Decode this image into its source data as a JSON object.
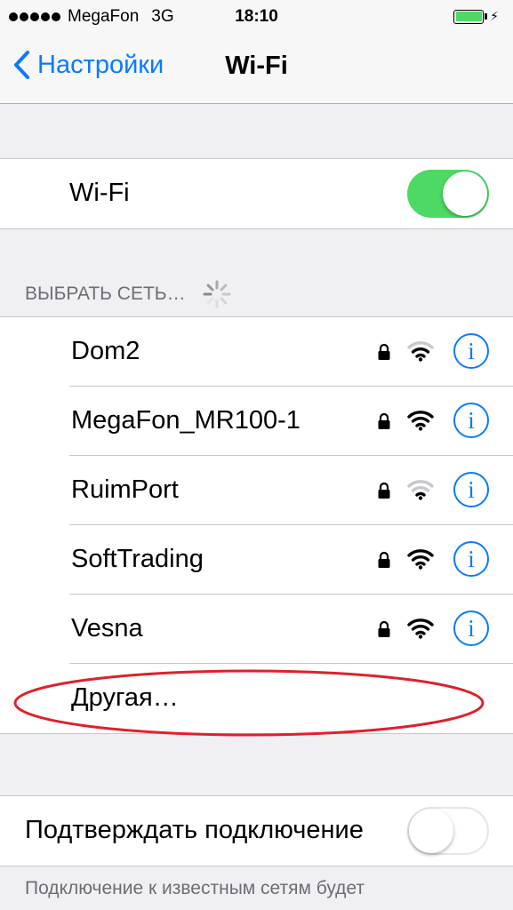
{
  "status_bar": {
    "carrier": "MegaFon",
    "network": "3G",
    "time": "18:10",
    "signal_dots": 5,
    "battery_level": 1.0,
    "battery_color": "#4cd964"
  },
  "nav": {
    "back_label": "Настройки",
    "title": "Wi-Fi",
    "accent": "#0a7bff"
  },
  "wifi_toggle": {
    "label": "Wi-Fi",
    "on": true
  },
  "networks_header": "ВЫБРАТЬ СЕТЬ…",
  "networks": [
    {
      "name": "Dom2",
      "locked": true,
      "signal": 2,
      "info_icon": "i"
    },
    {
      "name": "MegaFon_MR100-1",
      "locked": true,
      "signal": 3,
      "info_icon": "i"
    },
    {
      "name": "RuimPort",
      "locked": true,
      "signal": 1,
      "info_icon": "i"
    },
    {
      "name": "SoftTrading",
      "locked": true,
      "signal": 3,
      "info_icon": "i"
    },
    {
      "name": "Vesna",
      "locked": true,
      "signal": 3,
      "info_icon": "i"
    }
  ],
  "other_network": "Другая…",
  "ask_to_join": {
    "label": "Подтверждать подключение",
    "on": false
  },
  "footer_text": "Подключение к известным сетям будет"
}
